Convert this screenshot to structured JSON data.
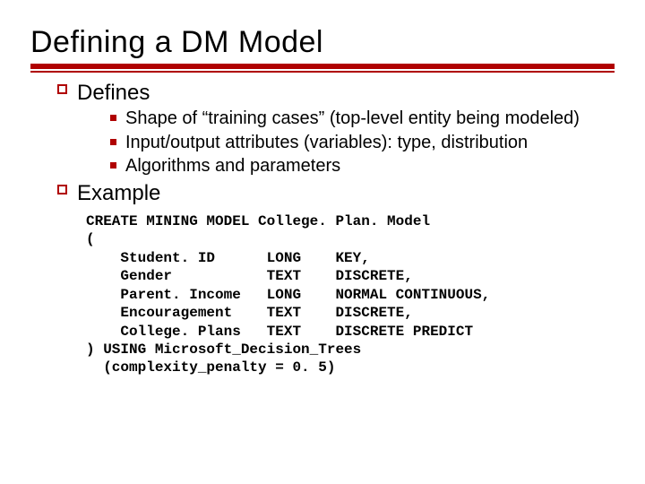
{
  "title": "Defining a DM Model",
  "sections": {
    "s1": {
      "heading": "Defines"
    },
    "s2": {
      "heading": "Example"
    }
  },
  "defines_items": {
    "i0": "Shape of “training cases” (top-level entity being modeled)",
    "i1": "Input/output attributes (variables): type, distribution",
    "i2": "Algorithms and parameters"
  },
  "code": "CREATE MINING MODEL College. Plan. Model\n(\n    Student. ID      LONG    KEY,\n    Gender           TEXT    DISCRETE,\n    Parent. Income   LONG    NORMAL CONTINUOUS,\n    Encouragement    TEXT    DISCRETE,\n    College. Plans   TEXT    DISCRETE PREDICT\n) USING Microsoft_Decision_Trees\n  (complexity_penalty = 0. 5)"
}
